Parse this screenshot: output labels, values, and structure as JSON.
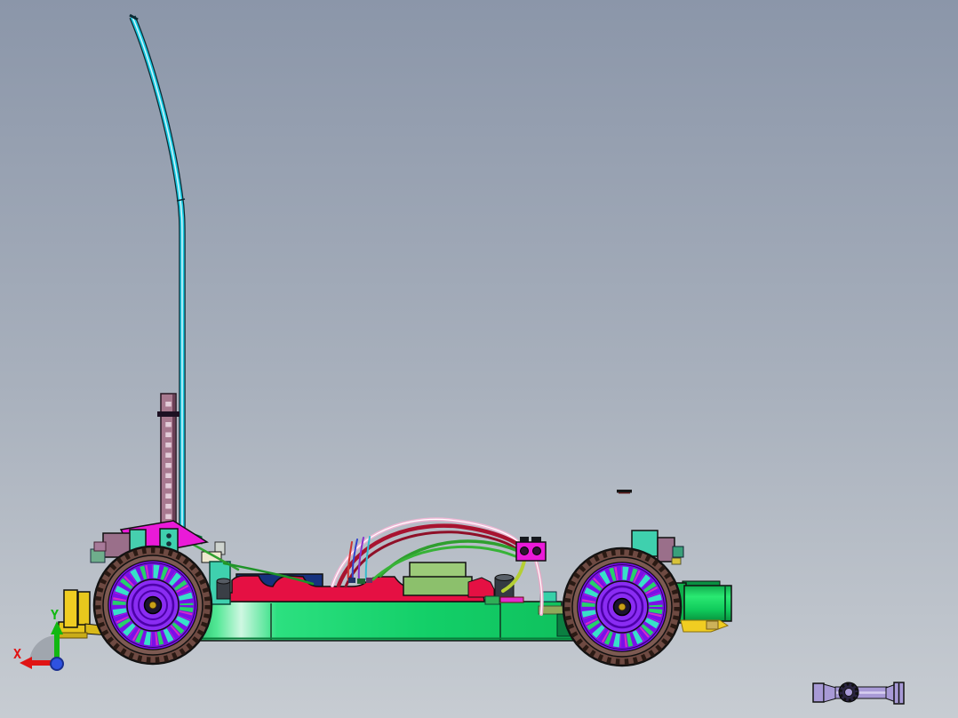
{
  "viewport": {
    "kind": "3d-cad-viewport",
    "model": "rc-car-chassis-side-view",
    "background_top": "#8b96a9",
    "background_bottom": "#c7ccd2"
  },
  "triad": {
    "x_label": "X",
    "y_label": "Y",
    "x_color": "#e01414",
    "y_color": "#12b812",
    "z_origin_color": "#2f52e0"
  },
  "parts": [
    {
      "name": "antenna-tube",
      "color": "#19c8e0"
    },
    {
      "name": "antenna-mount-tube",
      "color": "#a8798f"
    },
    {
      "name": "front-wheel",
      "tire": "#6e4a42",
      "rim": "#7a10e8"
    },
    {
      "name": "rear-wheel",
      "tire": "#6e4a42",
      "rim": "#7a10e8"
    },
    {
      "name": "chassis-deck",
      "color": "#13cf68"
    },
    {
      "name": "battery-pack",
      "color": "#e51043"
    },
    {
      "name": "esc-box",
      "color": "#8cc06c"
    },
    {
      "name": "steering-servo",
      "color": "#3fd0ae"
    },
    {
      "name": "wire-connector-block",
      "color": "#ea1ad8"
    },
    {
      "name": "front-bumper",
      "color": "#f0cd22"
    },
    {
      "name": "motor-unit",
      "color": "#12c95a"
    },
    {
      "name": "spare-driveshaft-part",
      "color": "#a89ad6"
    }
  ],
  "colors": {
    "bg_top": "#8b96a9",
    "bg_bottom": "#c7ccd2",
    "tire": "#6e4a42",
    "tire2": "#7d5a52",
    "rim": "#7a10e8",
    "hub": "#8a2cf2",
    "hub_line": "#4c00a8",
    "spoke_green": "#27d06a",
    "spoke_cyan": "#38e0c8",
    "spoke_magenta": "#d42cc8",
    "chassis": "#13cf68",
    "battery": "#e51043",
    "navy": "#16327e",
    "esc": "#8cc06c",
    "antenna": "#19c8e0",
    "holder": "#a8798f",
    "magenta": "#ea1ad8",
    "teal": "#3fd0ae",
    "mauve": "#9a6f8a",
    "yellow": "#f0cd22",
    "motor": "#12c95a",
    "wire_red": "#a81330",
    "wire_pink": "#f0b8d6",
    "wire_green": "#2f9f2f",
    "wire_yg": "#b5cf33",
    "axis_x": "#e01414",
    "axis_y": "#12b812",
    "axis_z": "#2f52e0",
    "part_purple": "#a89ad6"
  }
}
